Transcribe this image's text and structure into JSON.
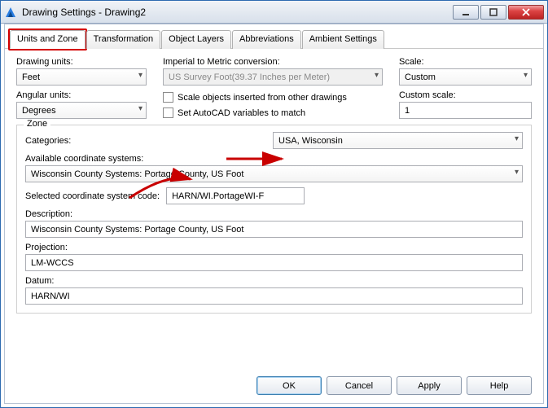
{
  "window": {
    "title": "Drawing Settings - Drawing2"
  },
  "tabs": [
    "Units and Zone",
    "Transformation",
    "Object Layers",
    "Abbreviations",
    "Ambient Settings"
  ],
  "units": {
    "drawing_label": "Drawing units:",
    "drawing_value": "Feet",
    "angular_label": "Angular units:",
    "angular_value": "Degrees",
    "conv_label": "Imperial to Metric conversion:",
    "conv_value": "US Survey Foot(39.37 Inches per Meter)",
    "chk_scale_objects": "Scale objects inserted from other drawings",
    "chk_autocad_vars": "Set AutoCAD variables to match",
    "scale_label": "Scale:",
    "scale_value": "Custom",
    "custom_scale_label": "Custom scale:",
    "custom_scale_value": "1"
  },
  "zone": {
    "legend": "Zone",
    "categories_label": "Categories:",
    "categories_value": "USA, Wisconsin",
    "available_label": "Available coordinate systems:",
    "available_value": "Wisconsin County Systems: Portage County, US Foot",
    "selected_code_label": "Selected coordinate system code:",
    "selected_code_value": "HARN/WI.PortageWI-F",
    "description_label": "Description:",
    "description_value": "Wisconsin County Systems: Portage County, US Foot",
    "projection_label": "Projection:",
    "projection_value": "LM-WCCS",
    "datum_label": "Datum:",
    "datum_value": "HARN/WI"
  },
  "buttons": {
    "ok": "OK",
    "cancel": "Cancel",
    "apply": "Apply",
    "help": "Help"
  }
}
